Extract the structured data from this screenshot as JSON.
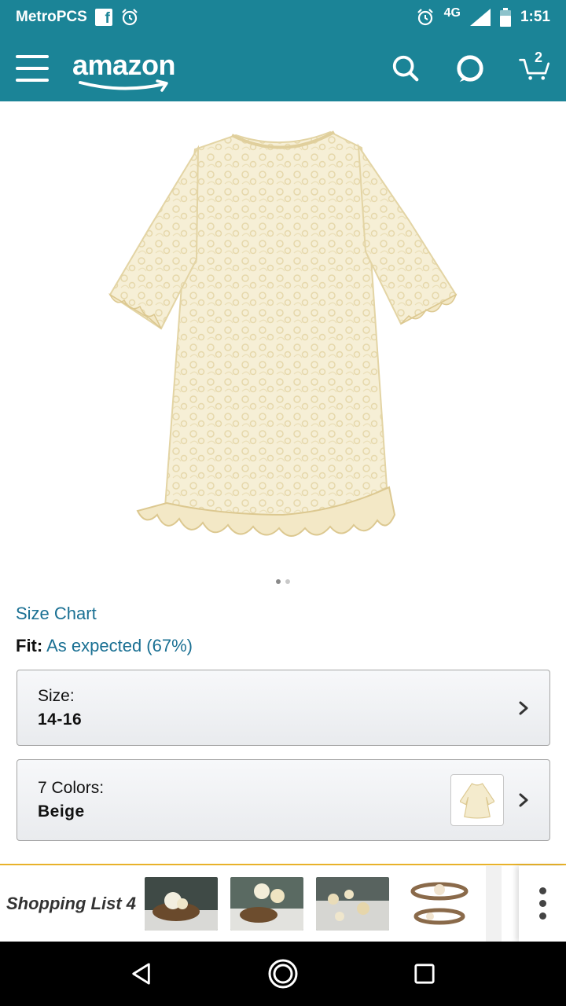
{
  "status_bar": {
    "carrier": "MetroPCS",
    "network": "4G",
    "time": "1:51",
    "icons": [
      "facebook-icon",
      "alarm-icon",
      "alarm-icon",
      "signal-icon",
      "battery-icon"
    ]
  },
  "header": {
    "logo_text": "amazon",
    "cart_count": "2",
    "icons": [
      "menu-icon",
      "search-icon",
      "alexa-icon",
      "cart-icon"
    ],
    "brand_color": "#1b8497"
  },
  "product": {
    "image_alt": "product-image-lace-dress",
    "carousel": {
      "total": 2,
      "active": 1
    }
  },
  "links": {
    "size_chart": "Size Chart",
    "fit_label": "Fit:",
    "fit_value": "As expected (67%)"
  },
  "size_selector": {
    "label": "Size:",
    "value": "14-16"
  },
  "color_selector": {
    "label": "7 Colors:",
    "value": "Beige"
  },
  "shopping_list": {
    "title": "Shopping List 4",
    "item_count_visible": 5
  },
  "nav": {
    "icons": [
      "back-icon",
      "home-icon",
      "recents-icon"
    ]
  },
  "colors": {
    "link": "#1a7093",
    "accent": "#e8b22a"
  }
}
